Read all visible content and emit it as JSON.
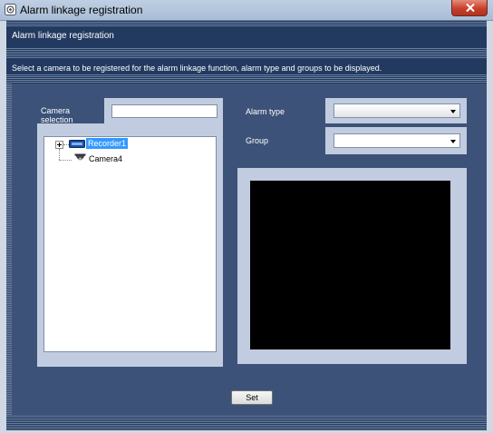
{
  "window": {
    "title": "Alarm linkage registration",
    "icon": "app-icon"
  },
  "header": {
    "title": "Alarm linkage registration",
    "instruction": "Select a camera to be registered for the alarm linkage function, alarm type and groups to be displayed."
  },
  "camera_selection": {
    "label": "Camera selection",
    "search_value": "",
    "tree": [
      {
        "label": "Recorder1",
        "icon": "recorder-icon",
        "selected": true,
        "expanded": false
      },
      {
        "label": "Camera4",
        "icon": "camera-icon",
        "selected": false
      }
    ]
  },
  "alarm_type": {
    "label": "Alarm type",
    "selected": ""
  },
  "group": {
    "label": "Group",
    "selected": ""
  },
  "actions": {
    "set_label": "Set"
  },
  "colors": {
    "background": "#223a60",
    "panel": "#c1cce0",
    "label_box": "#3c5278",
    "selection": "#3399ff",
    "preview": "#000000"
  }
}
